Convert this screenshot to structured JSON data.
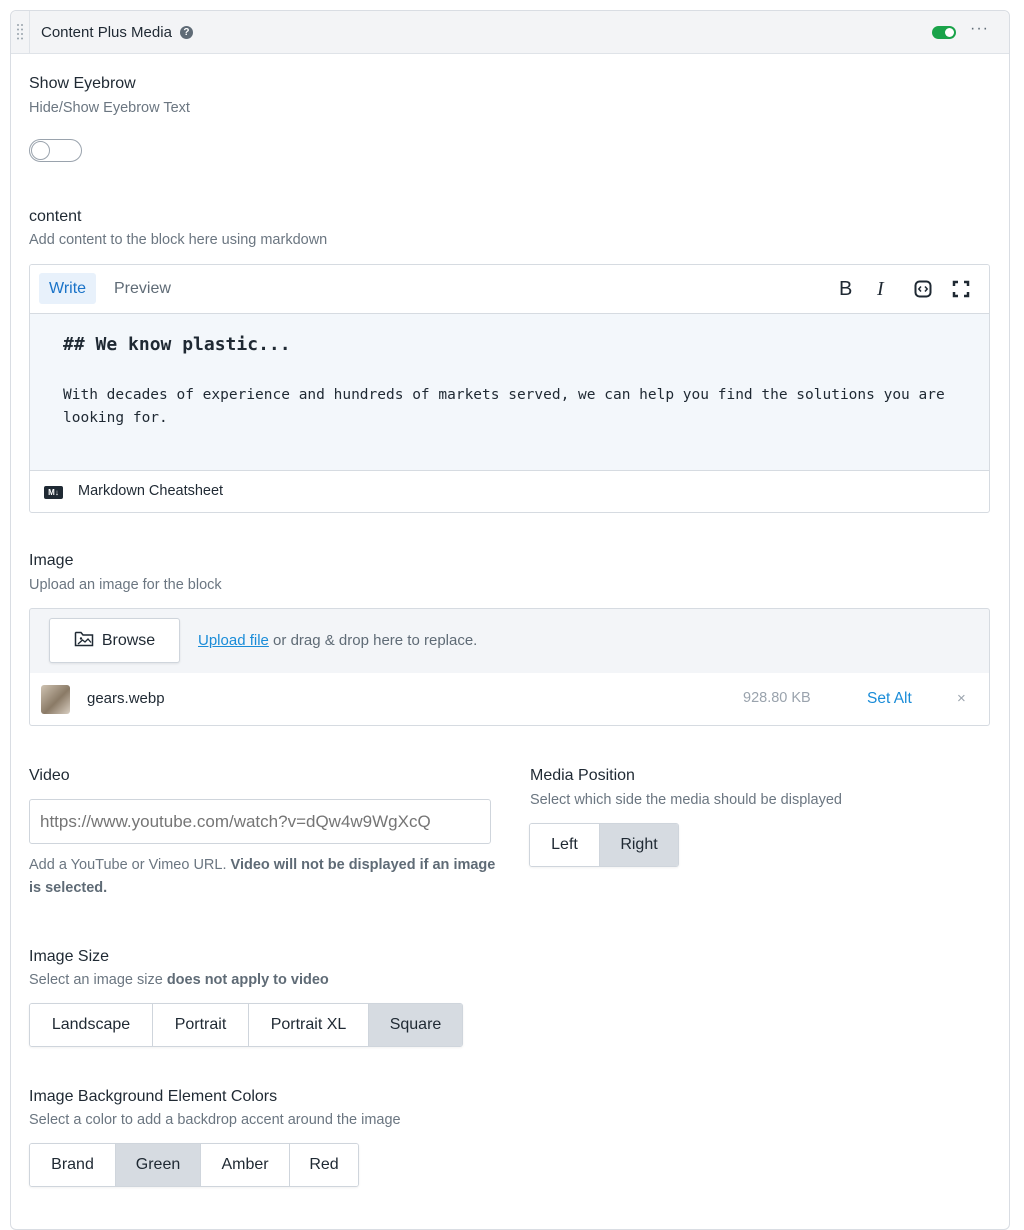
{
  "header": {
    "title": "Content Plus Media",
    "enabled": true
  },
  "show_eyebrow": {
    "label": "Show Eyebrow",
    "help": "Hide/Show Eyebrow Text",
    "enabled": false
  },
  "content": {
    "label": "content",
    "help": "Add content to the block here using markdown",
    "tabs": [
      "Write",
      "Preview"
    ],
    "active_tab": "Write",
    "toolbar": {
      "bold": "B",
      "italic": "I"
    },
    "heading": "## We know plastic...",
    "paragraph": "With decades of experience and hundreds of markets served, we can help you find the solutions you are looking for.",
    "md_badge": "M↓",
    "cheatsheet": "Markdown Cheatsheet"
  },
  "image": {
    "label": "Image",
    "help": "Upload an image for the block",
    "browse": "Browse",
    "upload_link": "Upload file",
    "upload_rest": " or drag & drop here to replace.",
    "file_name": "gears.webp",
    "file_size": "928.80 KB",
    "set_alt": "Set Alt",
    "remove": "×"
  },
  "video": {
    "label": "Video",
    "placeholder": "https://www.youtube.com/watch?v=dQw4w9WgXcQ",
    "help_plain": "Add a YouTube or Vimeo URL. ",
    "help_bold": "Video will not be displayed if an image is selected."
  },
  "media_position": {
    "label": "Media Position",
    "help": "Select which side the media should be displayed",
    "options": [
      "Left",
      "Right"
    ],
    "selected": "Right"
  },
  "image_size": {
    "label": "Image Size",
    "help_plain": "Select an image size ",
    "help_bold": "does not apply to video",
    "options": [
      "Landscape",
      "Portrait",
      "Portrait XL",
      "Square"
    ],
    "selected": "Square"
  },
  "bg_colors": {
    "label": "Image Background Element Colors",
    "help": "Select a color to add a backdrop accent around the image",
    "options": [
      "Brand",
      "Green",
      "Amber",
      "Red"
    ],
    "selected": "Green"
  },
  "colors": {
    "toggle_on": "#1aa34a",
    "link": "#1a8cd8",
    "active_tab": "#1a73c8"
  }
}
